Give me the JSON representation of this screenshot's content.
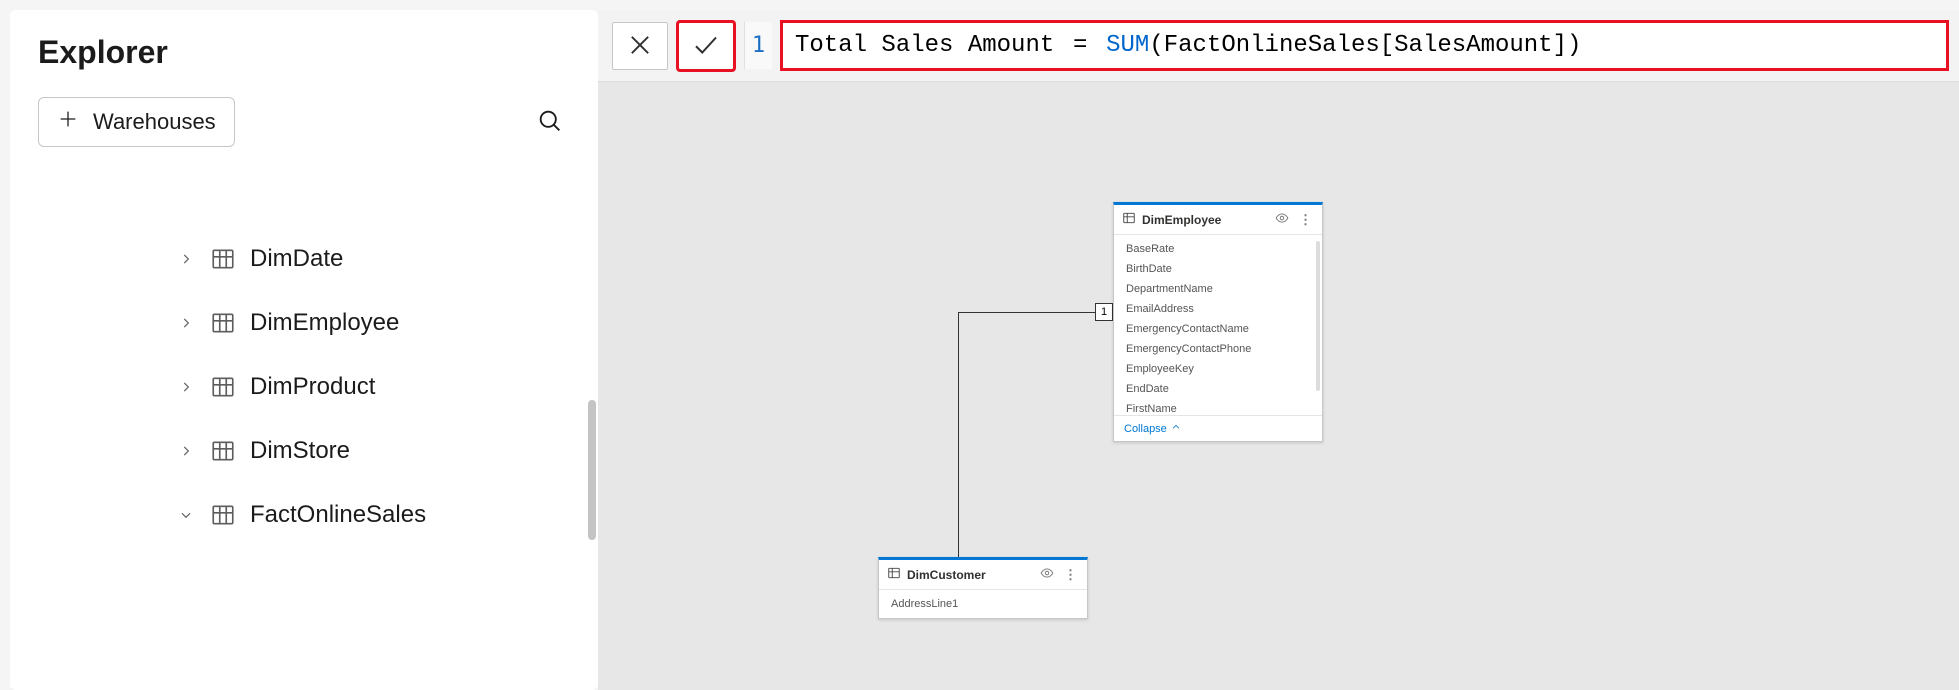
{
  "sidebar": {
    "title": "Explorer",
    "warehouses_button": "Warehouses",
    "tree": [
      {
        "label": "DimDate",
        "expanded": false
      },
      {
        "label": "DimEmployee",
        "expanded": false
      },
      {
        "label": "DimProduct",
        "expanded": false
      },
      {
        "label": "DimStore",
        "expanded": false
      },
      {
        "label": "FactOnlineSales",
        "expanded": true
      }
    ]
  },
  "formula_bar": {
    "line_number": "1",
    "measure_name": "Total Sales Amount",
    "equals": " = ",
    "function": "SUM",
    "open_paren": "(",
    "reference": "FactOnlineSales[SalesAmount]",
    "close_paren": ")"
  },
  "canvas": {
    "relationship_cardinality": "1",
    "entities": [
      {
        "id": "dim-employee",
        "name": "DimEmployee",
        "collapse_label": "Collapse",
        "fields": [
          "BaseRate",
          "BirthDate",
          "DepartmentName",
          "EmailAddress",
          "EmergencyContactName",
          "EmergencyContactPhone",
          "EmployeeKey",
          "EndDate",
          "FirstName"
        ]
      },
      {
        "id": "dim-customer",
        "name": "DimCustomer",
        "fields": [
          "AddressLine1"
        ]
      }
    ]
  }
}
